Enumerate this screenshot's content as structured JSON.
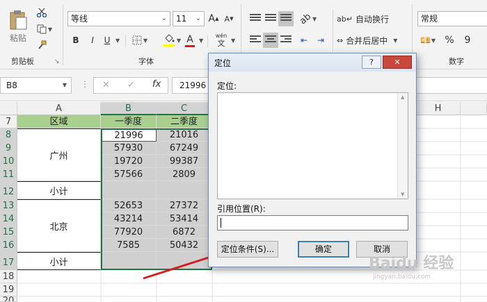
{
  "ribbon": {
    "clipboard": {
      "paste_label": "粘贴",
      "group_label": "剪贴板"
    },
    "font": {
      "family": "等线",
      "size": "11",
      "grow_label": "A",
      "shrink_label": "A",
      "bold": "B",
      "italic": "I",
      "underline": "U",
      "font_color": "A",
      "phonetic_label": "wén",
      "group_label": "字体"
    },
    "alignment": {
      "wrap_label": "自动换行",
      "merge_label": "合并后居中"
    },
    "number": {
      "format": "常规",
      "percent_label": "%",
      "comma_label": "9",
      "group_label": "数字"
    }
  },
  "formula_bar": {
    "name_box": "B8",
    "cancel_icon": "✕",
    "enter_icon": "✓",
    "fx_label": "fx",
    "value": "21996"
  },
  "grid": {
    "columns": [
      "A",
      "B",
      "C",
      "H"
    ],
    "rows": [
      "7",
      "8",
      "9",
      "10",
      "11",
      "12",
      "13",
      "14",
      "15",
      "16",
      "17",
      "18",
      "19",
      "20"
    ],
    "header_row": [
      "区域",
      "一季度",
      "二季度"
    ],
    "region_guangzhou": "广州",
    "region_beijing": "北京",
    "subtotal_1": "小计",
    "subtotal_2": "小计",
    "col_b": [
      "21996",
      "57930",
      "19720",
      "57566",
      "",
      "52653",
      "43214",
      "77920",
      "7585"
    ],
    "col_c": [
      "21016",
      "67249",
      "99387",
      "2809",
      "",
      "27372",
      "53414",
      "6872",
      "50432"
    ]
  },
  "dialog": {
    "title": "定位",
    "help_label": "?",
    "close_label": "✕",
    "goto_label": "定位:",
    "reference_label": "引用位置(R):",
    "reference_value": "",
    "special_button": "定位条件(S)...",
    "ok_button": "确定",
    "cancel_button": "取消"
  },
  "watermark": {
    "text": "Baidu 经验",
    "sub": "jingyan.baidu.com"
  },
  "colors": {
    "accent_green": "#217346",
    "header_fill": "#a9d08e",
    "selection_grey": "#d0d0d0",
    "arrow_red": "#d42020"
  }
}
